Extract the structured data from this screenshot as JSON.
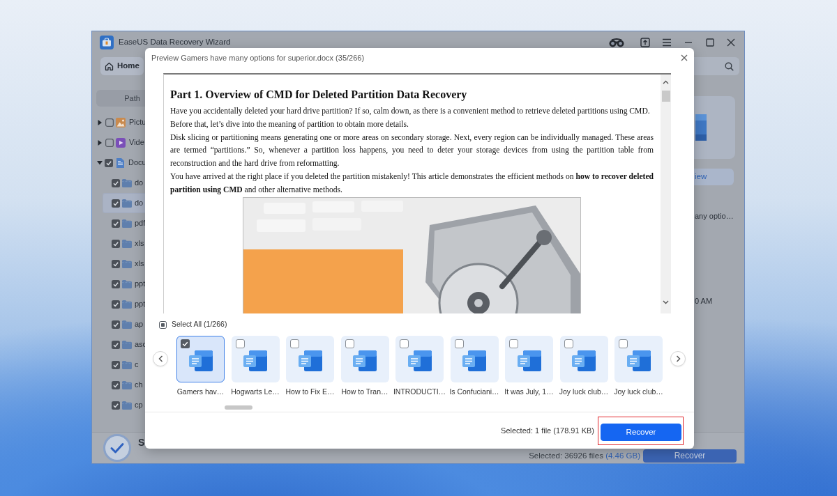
{
  "app": {
    "title": "EaseUS Data Recovery Wizard",
    "home_button": "Home",
    "path_tab": "Path",
    "tree": [
      {
        "label": "Pictu",
        "kind": "pictures",
        "expanded": false,
        "checked": false,
        "selected": false
      },
      {
        "label": "Vide",
        "kind": "videos",
        "expanded": false,
        "checked": false,
        "selected": false
      },
      {
        "label": "Docu",
        "kind": "documents",
        "expanded": true,
        "checked": true,
        "selected": false,
        "children": [
          {
            "label": "do",
            "checked": true,
            "selected": false
          },
          {
            "label": "do",
            "checked": true,
            "selected": true
          },
          {
            "label": "pdf",
            "checked": true,
            "selected": false
          },
          {
            "label": "xls",
            "checked": true,
            "selected": false
          },
          {
            "label": "xls",
            "checked": true,
            "selected": false
          },
          {
            "label": "ppt",
            "checked": true,
            "selected": false
          },
          {
            "label": "ppt",
            "checked": true,
            "selected": false
          },
          {
            "label": "ap",
            "checked": true,
            "selected": false
          },
          {
            "label": "asc",
            "checked": true,
            "selected": false
          },
          {
            "label": "c",
            "checked": true,
            "selected": false
          },
          {
            "label": "ch",
            "checked": true,
            "selected": false
          },
          {
            "label": "cp",
            "checked": true,
            "selected": false
          }
        ]
      }
    ],
    "details": {
      "preview_button": "iew",
      "file_name": "any optio…",
      "time": "0 AM"
    },
    "status_bar": {
      "heading": "S",
      "summary": "Selected: 36926 files",
      "size": "(4.46 GB)",
      "recover_button": "Recover"
    }
  },
  "dialog": {
    "title": "Preview Gamers have many options for superior.docx (35/266)",
    "document": {
      "heading": "Part 1. Overview of CMD for Deleted Partition Data Recovery",
      "paragraphs": [
        "Have you accidentally deleted your hard drive partition? If so, calm down, as there is a convenient method to retrieve deleted partitions using CMD.",
        "Before that, let’s dive into the meaning of partition to obtain more details.",
        "Disk slicing or partitioning means generating one or more areas on secondary storage. Next, every region can be individually managed. These areas are termed “partitions.” So, whenever a partition loss happens, you need to deter your storage devices from using the partition table from reconstruction and the hard drive from reformatting.",
        "You have arrived at the right place if you deleted the partition mistakenly! This article demonstrates the efficient methods on **how to recover deleted partition using CMD** and other alternative methods."
      ]
    },
    "select_all": {
      "label": "Select All (1/266)",
      "checked": false,
      "indeterminate": true
    },
    "thumbnails": [
      {
        "label": "Gamers hav…",
        "checked": true,
        "selected": true
      },
      {
        "label": "Hogwarts Le…",
        "checked": false,
        "selected": false
      },
      {
        "label": "How to Fix E…",
        "checked": false,
        "selected": false
      },
      {
        "label": "How to Tran…",
        "checked": false,
        "selected": false
      },
      {
        "label": "INTRODUCTI…",
        "checked": false,
        "selected": false
      },
      {
        "label": "Is Confuciani…",
        "checked": false,
        "selected": false
      },
      {
        "label": "It was July, 1…",
        "checked": false,
        "selected": false
      },
      {
        "label": "Joy luck club…",
        "checked": false,
        "selected": false
      },
      {
        "label": "Joy luck club…",
        "checked": false,
        "selected": false
      }
    ],
    "footer": {
      "summary": "Selected: 1 file (178.91 KB)",
      "recover_button": {
        "label": "Recover",
        "highlighted": true
      }
    }
  }
}
